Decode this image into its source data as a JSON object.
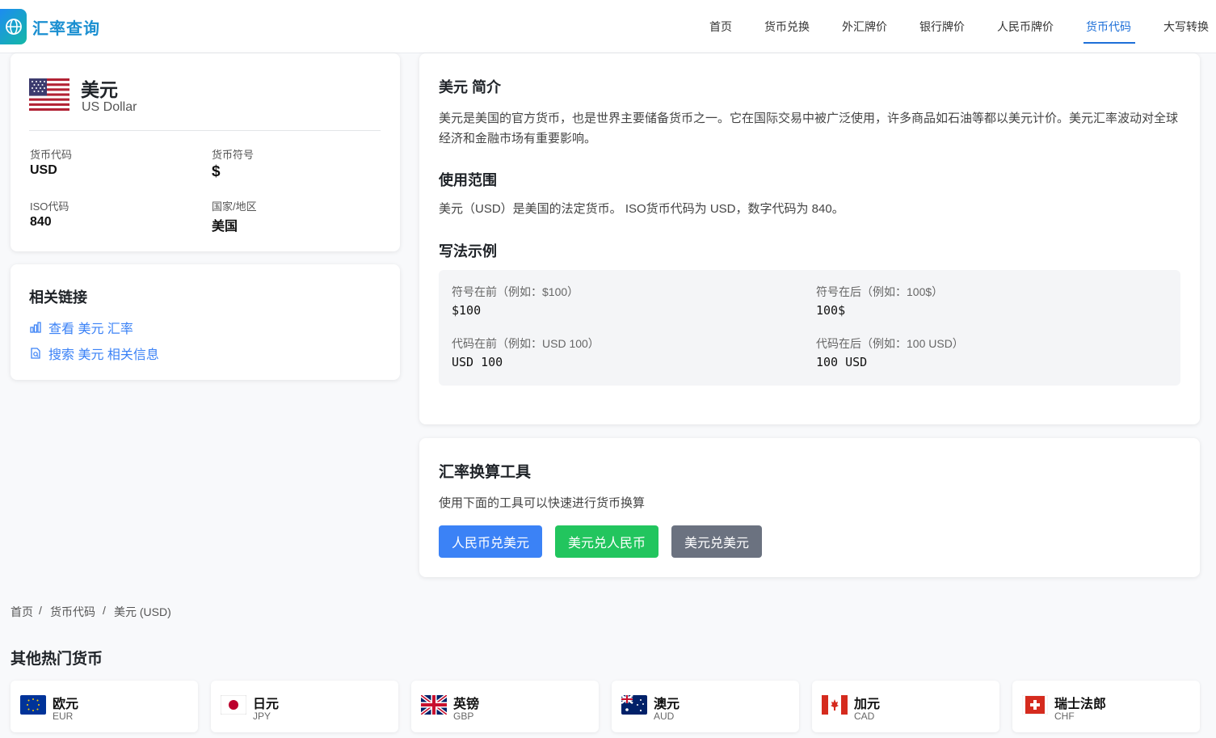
{
  "header": {
    "logo_text": "汇率查询",
    "nav": [
      "首页",
      "货币兑换",
      "外汇牌价",
      "银行牌价",
      "人民币牌价",
      "货币代码",
      "大写转换"
    ],
    "active_index": 5,
    "accent_color": "#1d6fd8"
  },
  "currency": {
    "flag_icon": "us-flag-icon",
    "name": "美元",
    "english": "US Dollar",
    "code_label": "货币代码",
    "code": "USD",
    "symbol_label": "货币符号",
    "symbol": "$",
    "iso_label": "ISO代码",
    "iso": "840",
    "country_label": "国家/地区",
    "country": "美国"
  },
  "links": {
    "title": "相关链接",
    "view_rate": "查看 美元 汇率",
    "search_info": "搜索 美元 相关信息"
  },
  "intro": {
    "title": "美元 简介",
    "description": "美元是美国的官方货币，也是世界主要储备货币之一。它在国际交易中被广泛使用，许多商品如石油等都以美元计价。美元汇率波动对全球经济和金融市场有重要影响。",
    "usage_title": "使用范围",
    "usage_text": "美元（USD）是美国的法定货币。 ISO货币代码为 USD，数字代码为 840。",
    "examples_title": "写法示例",
    "examples": [
      {
        "label": "符号在前（例如：$100）",
        "value": "$100"
      },
      {
        "label": "符号在后（例如：100$）",
        "value": "100$"
      },
      {
        "label": "代码在前（例如：USD 100）",
        "value": "USD 100"
      },
      {
        "label": "代码在后（例如：100 USD）",
        "value": "100 USD"
      }
    ]
  },
  "tool": {
    "title": "汇率换算工具",
    "subtitle": "使用下面的工具可以快速进行货币换算",
    "buttons": [
      {
        "label": "人民币兑美元",
        "color": "#3b82f6"
      },
      {
        "label": "美元兑人民币",
        "color": "#22c55e"
      },
      {
        "label": "美元兑美元",
        "color": "#6b7280"
      }
    ]
  },
  "breadcrumb": [
    "首页",
    "货币代码",
    "美元 (USD)"
  ],
  "popular": {
    "title": "其他热门货币",
    "items": [
      {
        "name": "欧元",
        "code": "EUR",
        "flag": "eu-flag-icon"
      },
      {
        "name": "日元",
        "code": "JPY",
        "flag": "jp-flag-icon"
      },
      {
        "name": "英镑",
        "code": "GBP",
        "flag": "gb-flag-icon"
      },
      {
        "name": "澳元",
        "code": "AUD",
        "flag": "au-flag-icon"
      },
      {
        "name": "加元",
        "code": "CAD",
        "flag": "ca-flag-icon"
      },
      {
        "name": "瑞士法郎",
        "code": "CHF",
        "flag": "ch-flag-icon"
      }
    ]
  }
}
